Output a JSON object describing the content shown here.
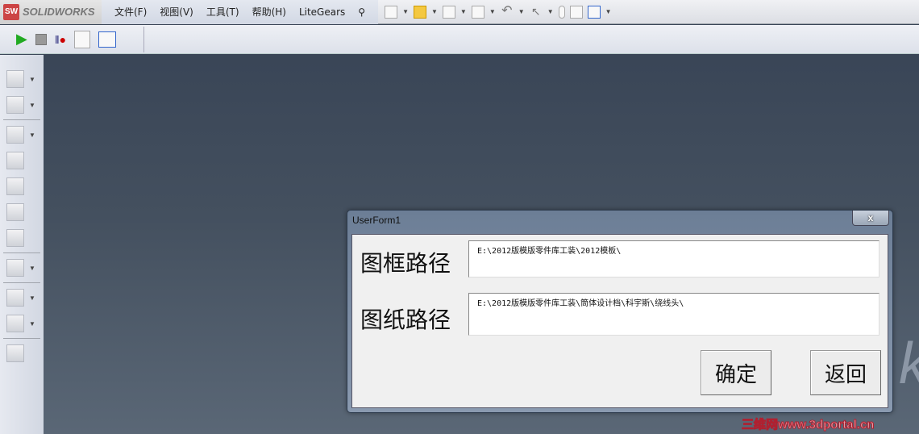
{
  "app": {
    "logo_text": "SOLIDWORKS",
    "logo_mark": "SW"
  },
  "menu": [
    "文件(F)",
    "视图(V)",
    "工具(T)",
    "帮助(H)",
    "LiteGears"
  ],
  "dialog": {
    "title": "UserForm1",
    "close_label": "x",
    "frame_path_label": "图框路径",
    "frame_path_value": "E:\\2012版模版零件库工装\\2012模板\\",
    "drawing_path_label": "图纸路径",
    "drawing_path_value": "E:\\2012版模版零件库工装\\筒体设计档\\科宇斯\\绕线头\\",
    "ok_label": "确定",
    "back_label": "返回"
  },
  "background_text": "k",
  "watermark": "三维网www.3dportal.cn"
}
